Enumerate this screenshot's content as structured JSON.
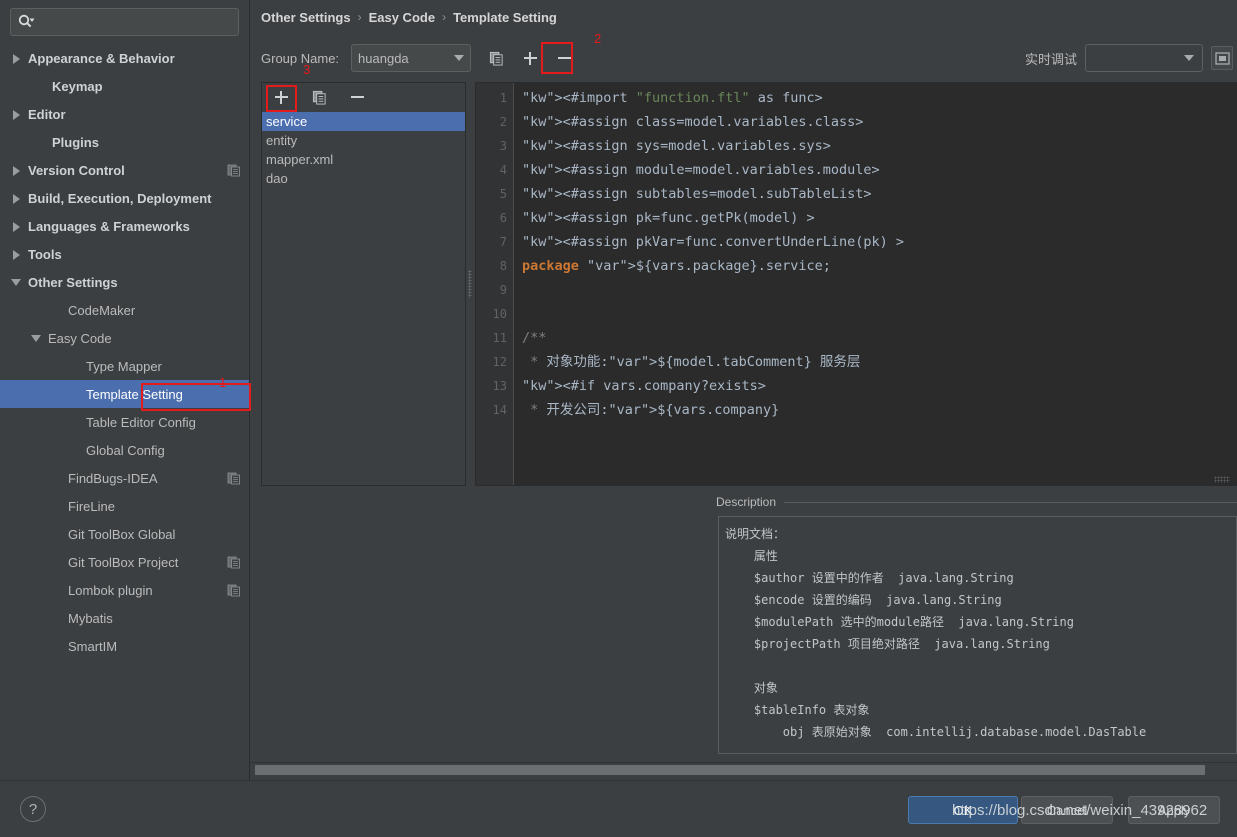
{
  "search": {
    "placeholder": "",
    "value": "",
    "icon": "search-icon"
  },
  "sidebar": {
    "items": [
      {
        "label": "Appearance & Behavior",
        "arrow": "collapsed",
        "indent": 10,
        "bold": true,
        "selected": false,
        "project_icon": false
      },
      {
        "label": "Keymap",
        "arrow": "none",
        "indent": 34,
        "bold": true,
        "selected": false,
        "project_icon": false
      },
      {
        "label": "Editor",
        "arrow": "collapsed",
        "indent": 10,
        "bold": true,
        "selected": false,
        "project_icon": false
      },
      {
        "label": "Plugins",
        "arrow": "none",
        "indent": 34,
        "bold": true,
        "selected": false,
        "project_icon": false
      },
      {
        "label": "Version Control",
        "arrow": "collapsed",
        "indent": 10,
        "bold": true,
        "selected": false,
        "project_icon": true
      },
      {
        "label": "Build, Execution, Deployment",
        "arrow": "collapsed",
        "indent": 10,
        "bold": true,
        "selected": false,
        "project_icon": false
      },
      {
        "label": "Languages & Frameworks",
        "arrow": "collapsed",
        "indent": 10,
        "bold": true,
        "selected": false,
        "project_icon": false
      },
      {
        "label": "Tools",
        "arrow": "collapsed",
        "indent": 10,
        "bold": true,
        "selected": false,
        "project_icon": false
      },
      {
        "label": "Other Settings",
        "arrow": "expanded",
        "indent": 10,
        "bold": true,
        "selected": false,
        "project_icon": false
      },
      {
        "label": "CodeMaker",
        "arrow": "none",
        "indent": 50,
        "bold": false,
        "selected": false,
        "project_icon": false
      },
      {
        "label": "Easy Code",
        "arrow": "expanded",
        "indent": 30,
        "bold": false,
        "selected": false,
        "project_icon": false
      },
      {
        "label": "Type Mapper",
        "arrow": "none",
        "indent": 68,
        "bold": false,
        "selected": false,
        "project_icon": false
      },
      {
        "label": "Template Setting",
        "arrow": "none",
        "indent": 68,
        "bold": false,
        "selected": true,
        "project_icon": false
      },
      {
        "label": "Table Editor Config",
        "arrow": "none",
        "indent": 68,
        "bold": false,
        "selected": false,
        "project_icon": false
      },
      {
        "label": "Global Config",
        "arrow": "none",
        "indent": 68,
        "bold": false,
        "selected": false,
        "project_icon": false
      },
      {
        "label": "FindBugs-IDEA",
        "arrow": "none",
        "indent": 50,
        "bold": false,
        "selected": false,
        "project_icon": true
      },
      {
        "label": "FireLine",
        "arrow": "none",
        "indent": 50,
        "bold": false,
        "selected": false,
        "project_icon": false
      },
      {
        "label": "Git ToolBox Global",
        "arrow": "none",
        "indent": 50,
        "bold": false,
        "selected": false,
        "project_icon": false
      },
      {
        "label": "Git ToolBox Project",
        "arrow": "none",
        "indent": 50,
        "bold": false,
        "selected": false,
        "project_icon": true
      },
      {
        "label": "Lombok plugin",
        "arrow": "none",
        "indent": 50,
        "bold": false,
        "selected": false,
        "project_icon": true
      },
      {
        "label": "Mybatis",
        "arrow": "none",
        "indent": 50,
        "bold": false,
        "selected": false,
        "project_icon": false
      },
      {
        "label": "SmartIM",
        "arrow": "none",
        "indent": 50,
        "bold": false,
        "selected": false,
        "project_icon": false
      }
    ]
  },
  "breadcrumb": {
    "part1": "Other Settings",
    "part2": "Easy Code",
    "part3": "Template Setting",
    "sep": "›"
  },
  "toolbar": {
    "group_label": "Group Name:",
    "group_value": "huangda",
    "copy_label": "copy-group",
    "add_label": "+",
    "remove_label": "−",
    "debug_label": "实时调试",
    "debug_value": ""
  },
  "template_panel": {
    "add_label": "+",
    "copy_label": "copy-template",
    "remove_label": "−",
    "items": [
      {
        "label": "service",
        "selected": true
      },
      {
        "label": "entity",
        "selected": false
      },
      {
        "label": "mapper.xml",
        "selected": false
      },
      {
        "label": "dao",
        "selected": false
      }
    ]
  },
  "editor": {
    "line_numbers": [
      "1",
      "2",
      "3",
      "4",
      "5",
      "6",
      "7",
      "8",
      "9",
      "10",
      "11",
      "12",
      "13",
      "14"
    ],
    "lines": [
      "<#import \"function.ftl\" as func>",
      "<#assign class=model.variables.class>",
      "<#assign sys=model.variables.sys>",
      "<#assign module=model.variables.module>",
      "<#assign subtables=model.subTableList>",
      "<#assign pk=func.getPk(model) >",
      "<#assign pkVar=func.convertUnderLine(pk) >",
      "package ${vars.package}.service;",
      "",
      "",
      "/**",
      " * 对象功能:${model.tabComment} 服务层",
      "<#if vars.company?exists>",
      " * 开发公司:${vars.company}"
    ]
  },
  "description": {
    "title": "Description",
    "text": "说明文档：\n    属性\n    $author 设置中的作者  java.lang.String\n    $encode 设置的编码  java.lang.String\n    $modulePath 选中的module路径  java.lang.String\n    $projectPath 项目绝对路径  java.lang.String\n\n    对象\n    $tableInfo 表对象\n        obj 表原始对象  com.intellij.database.model.DasTable"
  },
  "annotations": [
    {
      "num": "1"
    },
    {
      "num": "2"
    },
    {
      "num": "3"
    }
  ],
  "bottom": {
    "help_label": "?",
    "ok_label": "OK",
    "cancel_label": "Cancel",
    "apply_label": "Apply"
  },
  "watermark": {
    "text": "https://blog.csdn.net/weixin_43928962"
  },
  "colors": {
    "accent": "#4b6eaf",
    "primary_button": "#365880",
    "annotation": "#e41b1b",
    "editor_bg": "#2b2b2b",
    "panel_bg": "#3c3f41"
  }
}
